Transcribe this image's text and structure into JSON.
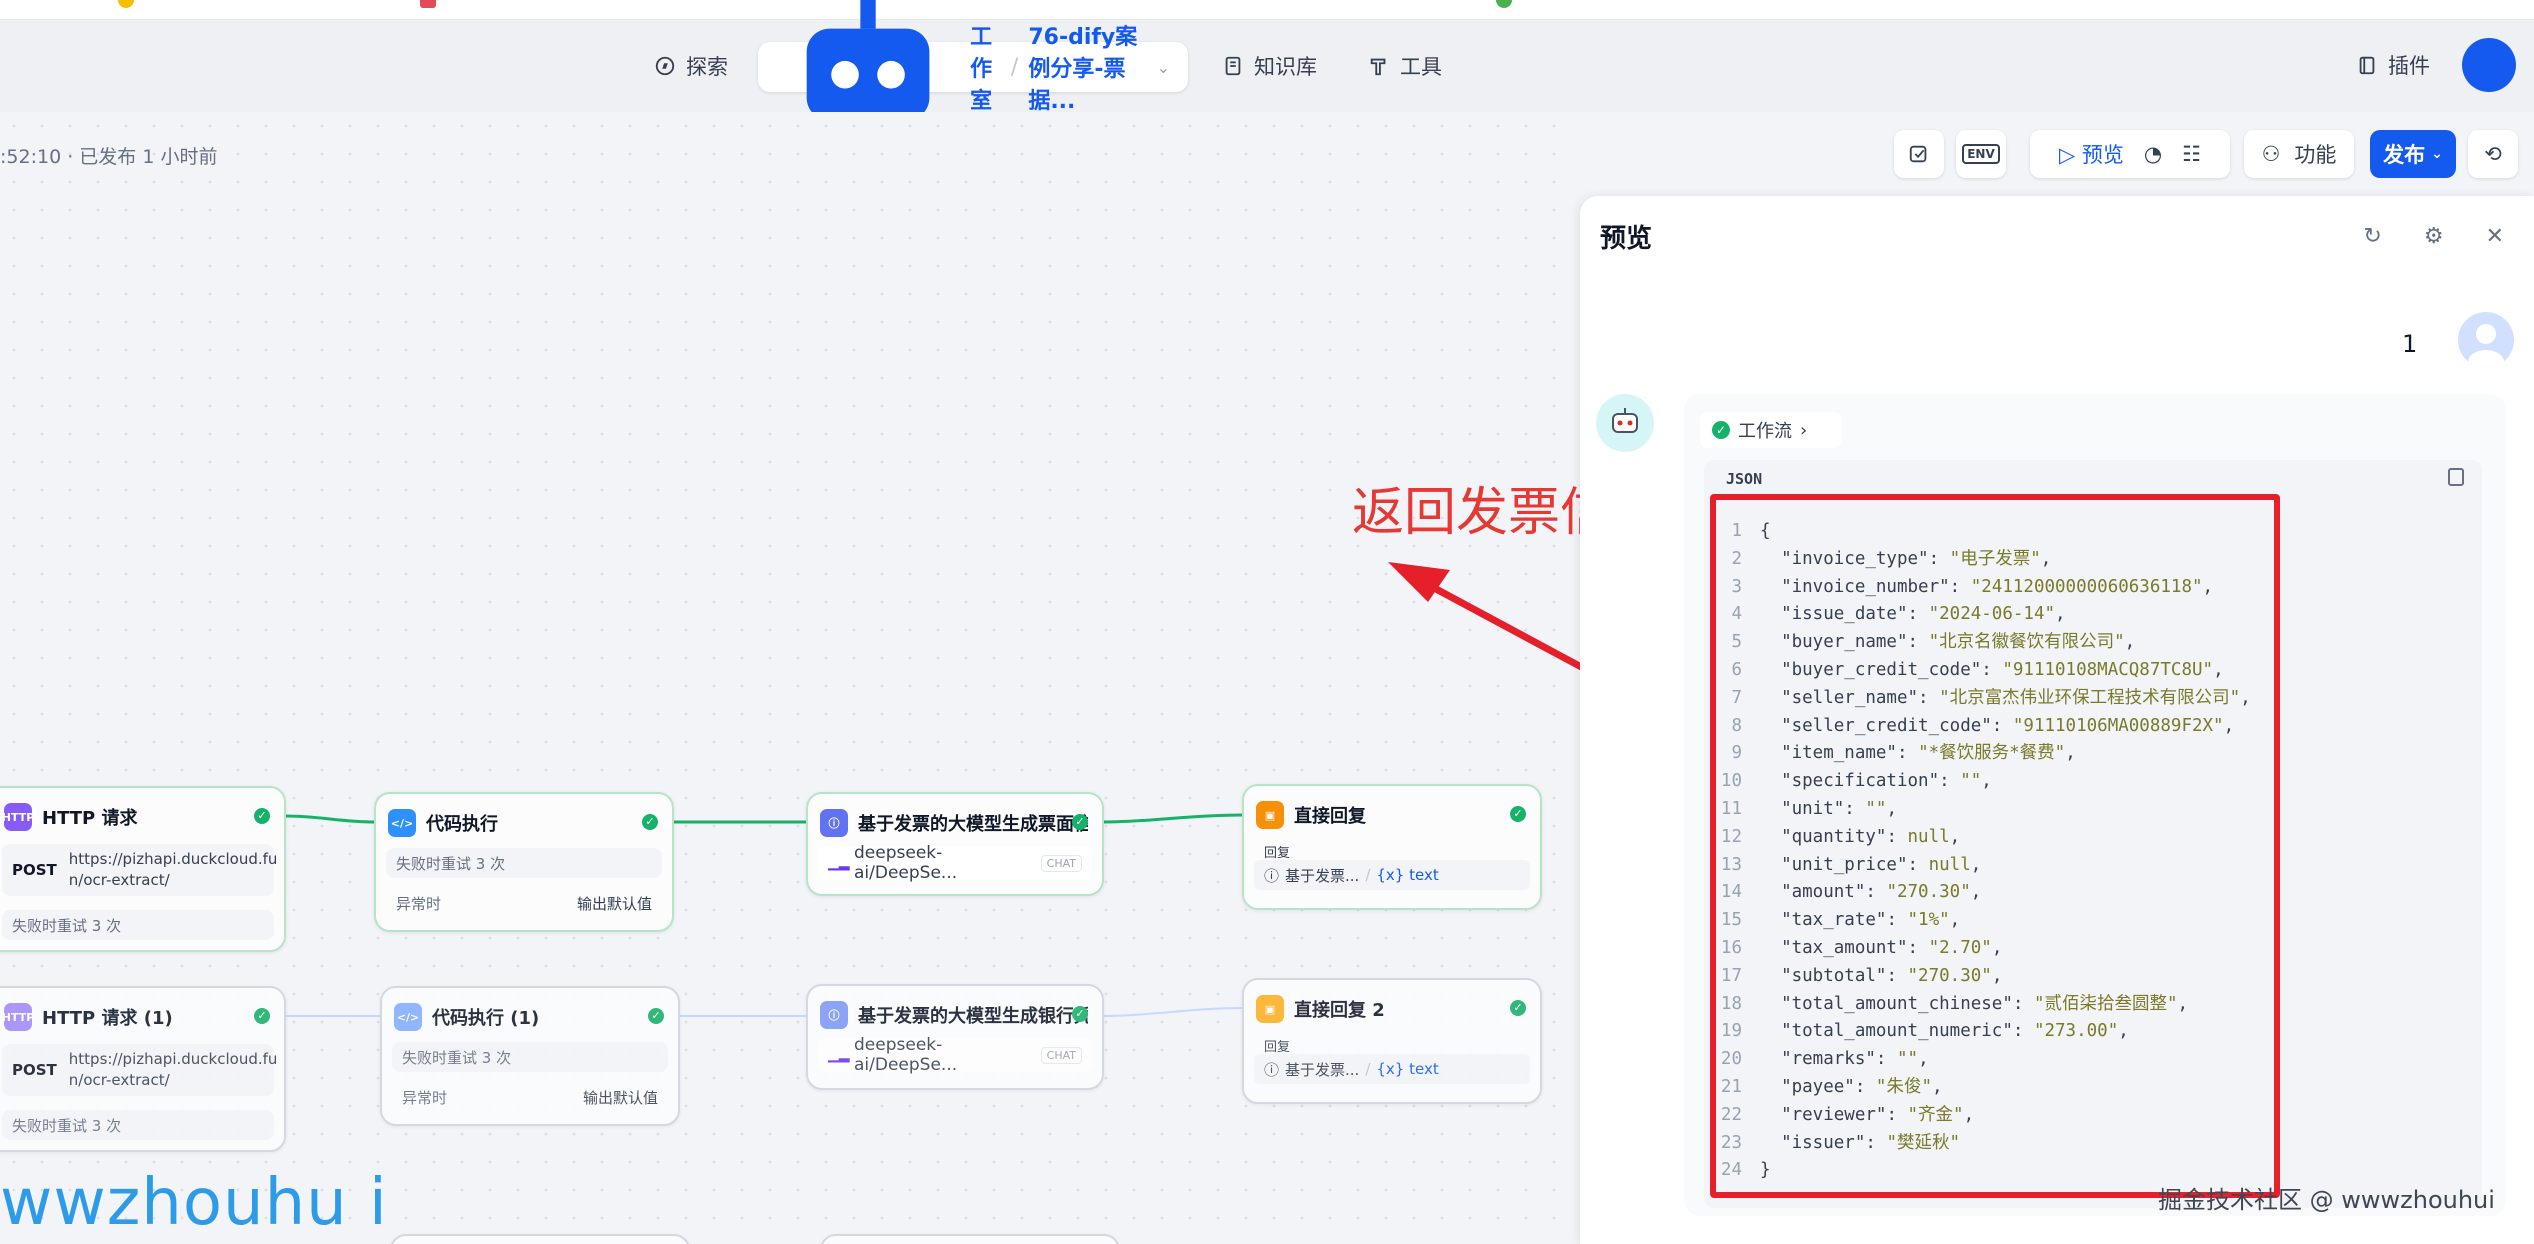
{
  "header": {
    "explore": "探索",
    "studio": "工作室",
    "app_name": "76-dify案例分享-票据...",
    "knowledge": "知识库",
    "tools": "工具",
    "plugins": "插件"
  },
  "status": ":52:10 · 已发布 1 小时前",
  "toolbar": {
    "env": "ENV",
    "preview": "预览",
    "features": "功能",
    "publish": "发布"
  },
  "nodes": {
    "http1": {
      "title": "HTTP 请求",
      "method": "POST",
      "url_line1": "https://pizhapi.duckcloud.fu",
      "url_line2": "n/ocr-extract/",
      "retry": "失败时重试 3 次"
    },
    "code1": {
      "title": "代码执行",
      "retry": "失败时重试 3 次",
      "on_error": "异常时",
      "on_error_value": "输出默认值"
    },
    "llm1": {
      "title": "基于发票的大模型生成票面信",
      "model": "deepseek-ai/DeepSe...",
      "tag": "CHAT"
    },
    "answer1": {
      "title": "直接回复",
      "reply_label": "回复",
      "ref": "基于发票...",
      "var": "{x} text"
    },
    "http2": {
      "title": "HTTP 请求 (1)",
      "method": "POST",
      "url_line1": "https://pizhapi.duckcloud.fu",
      "url_line2": "n/ocr-extract/",
      "retry": "失败时重试 3 次"
    },
    "code2": {
      "title": "代码执行 (1)",
      "retry": "失败时重试 3 次",
      "on_error": "异常时",
      "on_error_value": "输出默认值"
    },
    "llm2": {
      "title": "基于发票的大模型生成银行凭",
      "model": "deepseek-ai/DeepSe...",
      "tag": "CHAT"
    },
    "answer2": {
      "title": "直接回复 2",
      "reply_label": "回复",
      "ref": "基于发票...",
      "var": "{x} text"
    }
  },
  "annotation": "返回发票信息",
  "watermark_left": "wwzhouhu i",
  "panel": {
    "title": "预览",
    "user_message": "1",
    "workflow_chip": "工作流",
    "code_lang": "JSON"
  },
  "json_lines": [
    {
      "n": "1",
      "text": "{"
    },
    {
      "n": "2",
      "key": "\"invoice_type\"",
      "val": "\"电子发票\"",
      "end": ","
    },
    {
      "n": "3",
      "key": "\"invoice_number\"",
      "val": "\"24112000000060636118\"",
      "end": ","
    },
    {
      "n": "4",
      "key": "\"issue_date\"",
      "val": "\"2024-06-14\"",
      "end": ","
    },
    {
      "n": "5",
      "key": "\"buyer_name\"",
      "val": "\"北京名徽餐饮有限公司\"",
      "end": ","
    },
    {
      "n": "6",
      "key": "\"buyer_credit_code\"",
      "val": "\"91110108MACQ87TC8U\"",
      "end": ","
    },
    {
      "n": "7",
      "key": "\"seller_name\"",
      "val": "\"北京富杰伟业环保工程技术有限公司\"",
      "end": ","
    },
    {
      "n": "8",
      "key": "\"seller_credit_code\"",
      "val": "\"91110106MA00889F2X\"",
      "end": ","
    },
    {
      "n": "9",
      "key": "\"item_name\"",
      "val": "\"*餐饮服务*餐费\"",
      "end": ","
    },
    {
      "n": "10",
      "key": "\"specification\"",
      "val": "\"\"",
      "end": ","
    },
    {
      "n": "11",
      "key": "\"unit\"",
      "val": "\"\"",
      "end": ","
    },
    {
      "n": "12",
      "key": "\"quantity\"",
      "val": "null",
      "end": ","
    },
    {
      "n": "13",
      "key": "\"unit_price\"",
      "val": "null",
      "end": ","
    },
    {
      "n": "14",
      "key": "\"amount\"",
      "val": "\"270.30\"",
      "end": ","
    },
    {
      "n": "15",
      "key": "\"tax_rate\"",
      "val": "\"1%\"",
      "end": ","
    },
    {
      "n": "16",
      "key": "\"tax_amount\"",
      "val": "\"2.70\"",
      "end": ","
    },
    {
      "n": "17",
      "key": "\"subtotal\"",
      "val": "\"270.30\"",
      "end": ","
    },
    {
      "n": "18",
      "key": "\"total_amount_chinese\"",
      "val": "\"贰佰柒拾叁圆整\"",
      "end": ","
    },
    {
      "n": "19",
      "key": "\"total_amount_numeric\"",
      "val": "\"273.00\"",
      "end": ","
    },
    {
      "n": "20",
      "key": "\"remarks\"",
      "val": "\"\"",
      "end": ","
    },
    {
      "n": "21",
      "key": "\"payee\"",
      "val": "\"朱俊\"",
      "end": ","
    },
    {
      "n": "22",
      "key": "\"reviewer\"",
      "val": "\"齐金\"",
      "end": ","
    },
    {
      "n": "23",
      "key": "\"issuer\"",
      "val": "\"樊延秋\"",
      "end": ""
    },
    {
      "n": "24",
      "text": "}"
    }
  ],
  "watermark_right": "掘金技术社区 @ wwwzhouhui",
  "colors": {
    "accent": "#155aef",
    "success": "#17b26a",
    "annotation": "#e53935",
    "node_border_ok": "#b7e4c7"
  }
}
